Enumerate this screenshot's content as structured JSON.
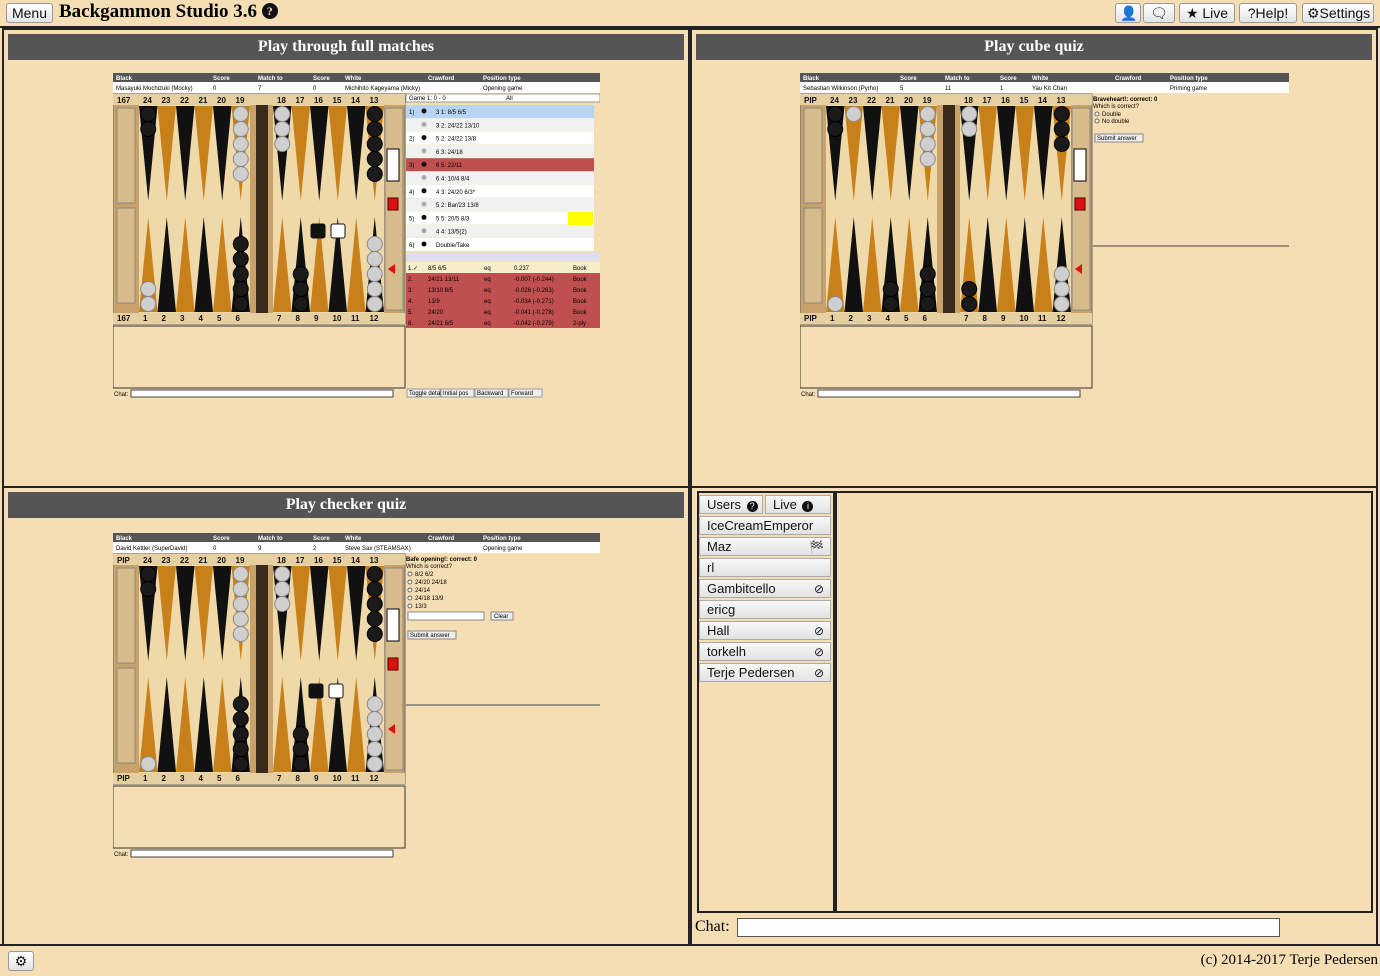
{
  "app": {
    "menu_label": "Menu",
    "title": "Backgammon Studio 3.6",
    "buttons": {
      "user": "",
      "chat": "",
      "live": "★ Live",
      "help": "?Help!",
      "settings": "⚙Settings"
    },
    "copyright": "(c) 2014-2017 Terje Pedersen"
  },
  "panels": {
    "full_matches": "Play through full matches",
    "cube_quiz": "Play cube quiz",
    "checker_quiz": "Play checker quiz"
  },
  "board_labels": {
    "black": "Black",
    "score": "Score",
    "match_to": "Match to",
    "white": "White",
    "crawford": "Crawford",
    "position_type": "Position type",
    "chat": "Chat:",
    "pip": "PIP",
    "top_points": [
      "24",
      "23",
      "22",
      "21",
      "20",
      "19",
      "18",
      "17",
      "16",
      "15",
      "14",
      "13"
    ],
    "bottom_points": [
      "1",
      "2",
      "3",
      "4",
      "5",
      "6",
      "7",
      "8",
      "9",
      "10",
      "11",
      "12"
    ]
  },
  "board1": {
    "black_player": "Masayuki Mochizuki (Mocky)",
    "black_score": "0",
    "match_to": "7",
    "white_score": "0",
    "white_player": "Michihito Kageyama (Micky)",
    "position_type": "Opening game",
    "pip_top": "167",
    "pip_bottom": "167",
    "game_select": "Game 1: 0 - 0",
    "filter_select": "All",
    "moves": [
      {
        "num": "1)",
        "text": "3 1: 8/5 6/5",
        "style": "blue"
      },
      {
        "num": "",
        "text": "3 2: 24/22 13/10",
        "style": "plain"
      },
      {
        "num": "2)",
        "text": "5 2: 24/22 13/8",
        "style": "plain"
      },
      {
        "num": "",
        "text": "6 3: 24/18",
        "style": "plain"
      },
      {
        "num": "3)",
        "text": "6 5: 22/11",
        "style": "red"
      },
      {
        "num": "",
        "text": "6 4: 10/4 8/4",
        "style": "plain"
      },
      {
        "num": "4)",
        "text": "4 3: 24/20 6/3*",
        "style": "plain"
      },
      {
        "num": "",
        "text": "5 2: Bar/23 13/8",
        "style": "plain"
      },
      {
        "num": "5)",
        "text": "5 5: 20/5 8/3",
        "style": "plain"
      },
      {
        "num": "",
        "text": "4 4: 13/5(2)",
        "style": "plain"
      },
      {
        "num": "6)",
        "text": "Double/Take",
        "style": "plain"
      }
    ],
    "analysis": [
      {
        "rank": "1.✓",
        "move": "8/5 6/5",
        "eq": "eq",
        "val": "0.237",
        "src": "Book",
        "style": "cream"
      },
      {
        "rank": "2.",
        "move": "24/21 13/11",
        "eq": "eq",
        "val": "-0.007  (-0.244)",
        "src": "Book",
        "style": "red"
      },
      {
        "rank": "3.",
        "move": "13/10 8/5",
        "eq": "eq",
        "val": "-0.026  (-0.263)",
        "src": "Book",
        "style": "red"
      },
      {
        "rank": "4.",
        "move": "13/9",
        "eq": "eq",
        "val": "-0.034  (-0.271)",
        "src": "Book",
        "style": "red"
      },
      {
        "rank": "5.",
        "move": "24/20",
        "eq": "eq",
        "val": "-0.041  (-0.278)",
        "src": "Book",
        "style": "red"
      },
      {
        "rank": "6.",
        "move": "24/21 6/5",
        "eq": "eq",
        "val": "-0.042  (-0.279)",
        "src": "2-ply",
        "style": "red"
      }
    ],
    "nav_buttons": [
      "Toggle details",
      "Initial pos",
      "Backward",
      "Forward"
    ]
  },
  "board2": {
    "black_player": "Sebastian Wilkinson (Pyrho)",
    "black_score": "5",
    "match_to": "11",
    "white_score": "1",
    "white_player": "Yau Kit Chan",
    "position_type": "Priming game",
    "question_title": "Braveheart!: correct: 0",
    "question": "Which is correct?",
    "options": [
      "Double",
      "No double"
    ],
    "submit": "Submit answer"
  },
  "board3": {
    "black_player": "David Kettler (SuperDavid)",
    "black_score": "0",
    "match_to": "9",
    "white_score": "2",
    "white_player": "Steve Sax (STEAMSAX)",
    "position_type": "Opening game",
    "question_title": "Bafe opening!: correct: 0",
    "question": "Which is correct?",
    "options": [
      "8/2 6/2",
      "24/20 24/18",
      "24/14",
      "24/18 13/9",
      "13/3"
    ],
    "clear": "Clear",
    "submit": "Submit answer"
  },
  "users": {
    "tab_users": "Users",
    "tab_live": "Live",
    "list": [
      {
        "name": "IceCreamEmperor",
        "flag": ""
      },
      {
        "name": "Maz",
        "flag": "🏁"
      },
      {
        "name": "rl",
        "flag": ""
      },
      {
        "name": "Gambitcello",
        "flag": "⊘"
      },
      {
        "name": "ericg",
        "flag": ""
      },
      {
        "name": "Hall",
        "flag": "⊘"
      },
      {
        "name": "torkelh",
        "flag": "⊘"
      },
      {
        "name": "Terje Pedersen",
        "flag": "⊘"
      }
    ]
  },
  "chat": {
    "label": "Chat:",
    "value": ""
  },
  "colors": {
    "panel_header": "#555555",
    "page_bg": "#f5deb3",
    "dark_point": "#111111",
    "light_point": "#c8801a",
    "move_highlight": "#c05050"
  }
}
